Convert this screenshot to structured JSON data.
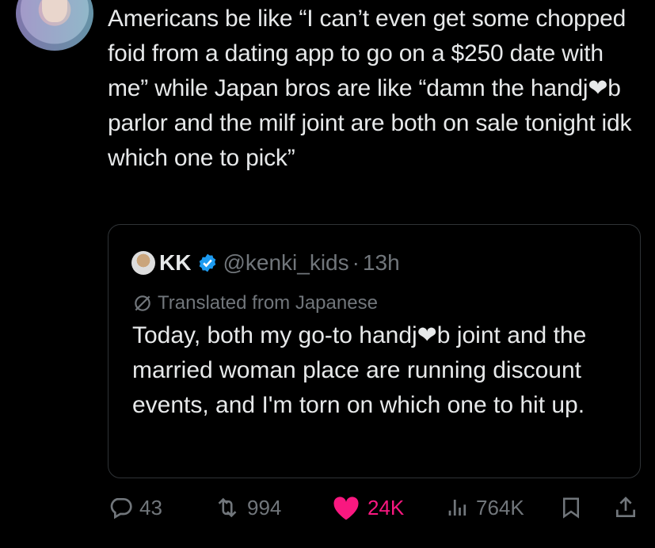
{
  "tweet": {
    "text": "Americans be like “I can’t even get some chopped foid from a dating app to go on a $250 date with me” while Japan bros are like “damn the handj❤b parlor and the milf joint are both on sale tonight idk which one to pick”"
  },
  "quote": {
    "name": "KK",
    "handle": "@kenki_kids",
    "dot": "·",
    "time": "13h",
    "translated_label": "Translated from Japanese",
    "text": "Today, both my go-to handj❤b joint and the married woman place are running discount events, and I'm torn on which one to hit up."
  },
  "actions": {
    "replies": "43",
    "reposts": "994",
    "likes": "24K",
    "views": "764K"
  },
  "colors": {
    "background": "#000000",
    "text": "#e7e9ea",
    "muted": "#71767b",
    "like": "#f91880",
    "verified": "#1d9bf0",
    "border": "#2f3336"
  },
  "icons": [
    "reply-icon",
    "repost-icon",
    "heart-icon",
    "views-icon",
    "bookmark-icon",
    "share-icon",
    "verified-badge-icon",
    "translate-icon"
  ]
}
